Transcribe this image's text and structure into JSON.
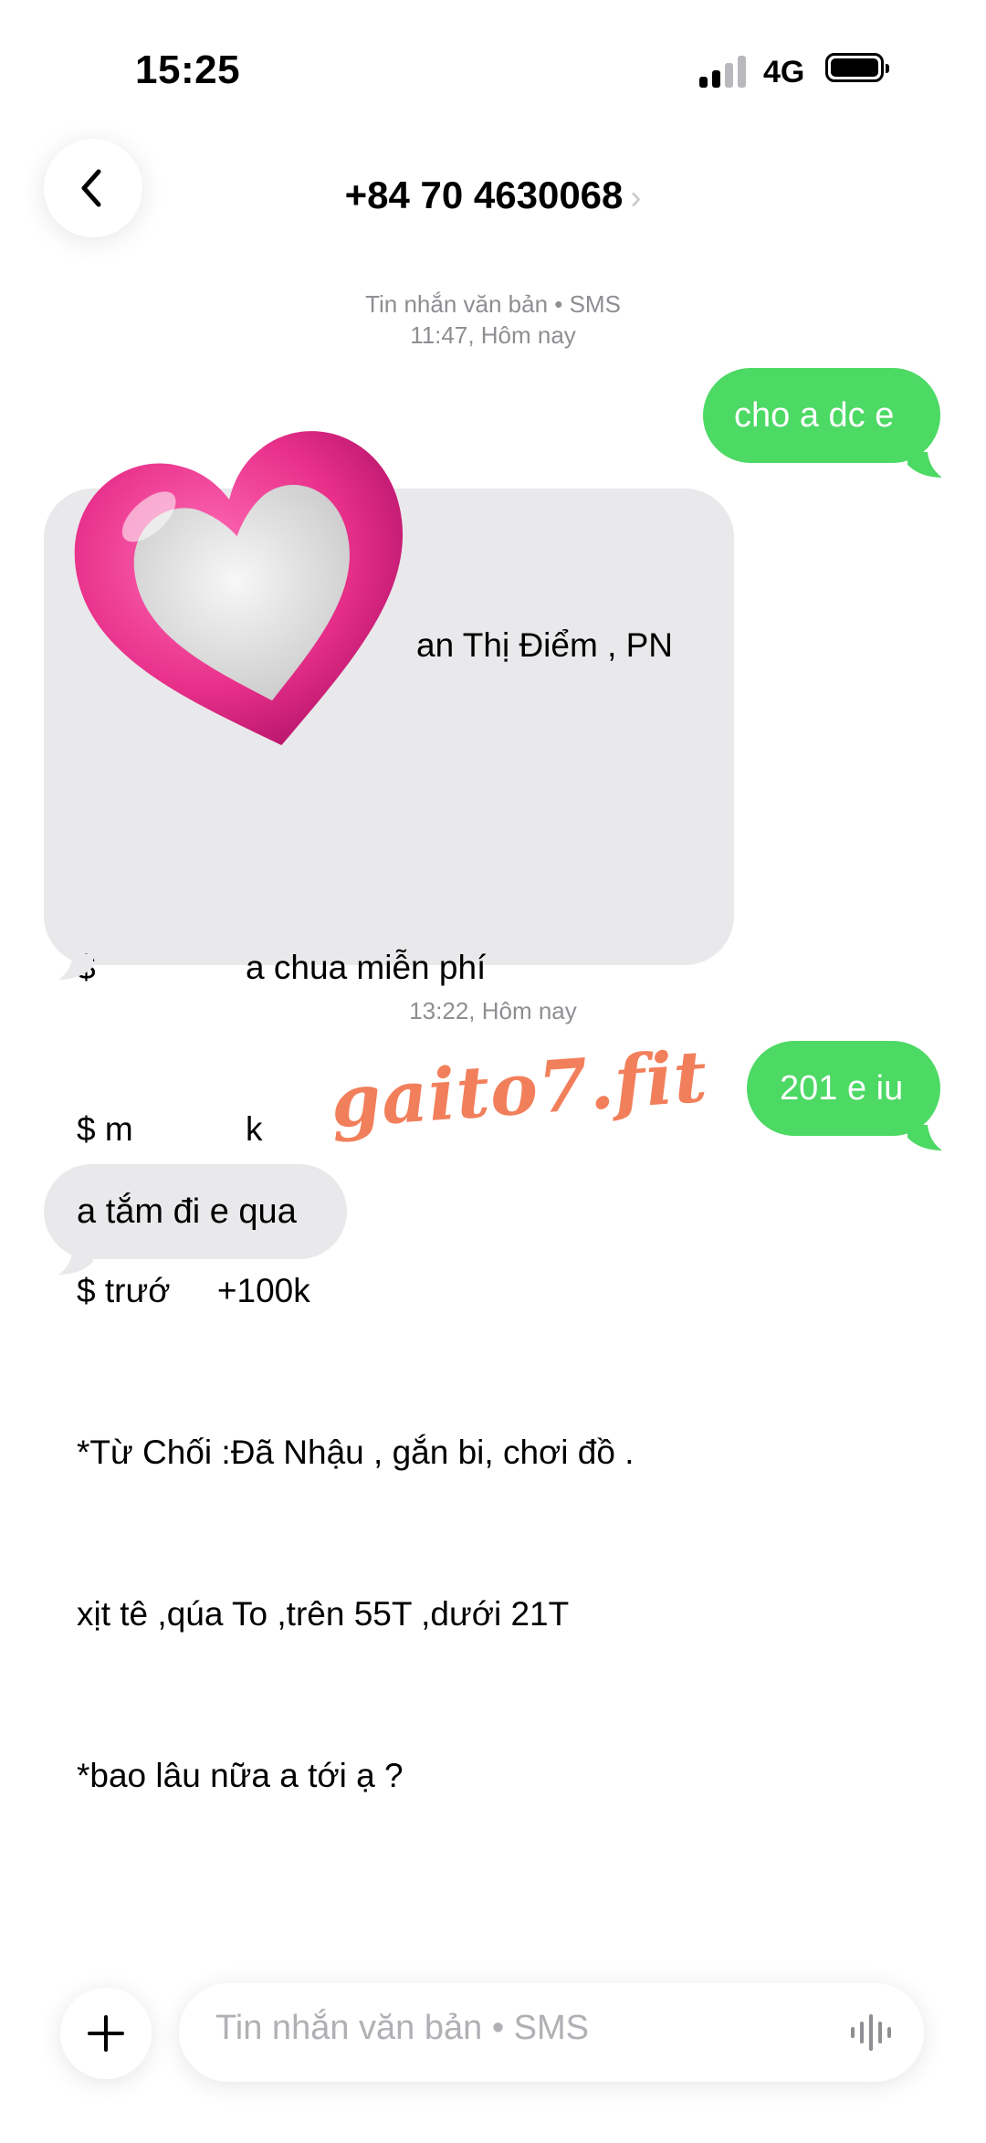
{
  "status_bar": {
    "time": "15:25",
    "network": "4G",
    "icons": [
      "signal-icon",
      "battery-icon"
    ]
  },
  "header": {
    "contact": "+84 70 4630068",
    "chevron": "›",
    "icons": [
      "back-chevron-icon",
      "chevron-right-icon"
    ]
  },
  "thread": {
    "timestamp1": {
      "line1": "Tin nhắn văn bản • SMS",
      "line2": "11:47, Hôm nay"
    },
    "timestamp2": "13:22, Hôm nay",
    "messages": [
      {
        "from": "me",
        "text": "cho a dc e"
      },
      {
        "from": "them",
        "lines": [
          "an Thị Điểm , PN",
          "$                a chua miễn phí",
          "$ m            k",
          "$ trướ     +100k",
          "*Từ Chối :Đã Nhậu , gắn bi, chơi đồ .",
          "xịt tê ,qúa To ,trên 55T ,dưới 21T",
          "*bao lâu nữa a tới ạ ?"
        ]
      },
      {
        "from": "me",
        "text": "201 e iu"
      },
      {
        "from": "them",
        "text": "a tắm đi e qua"
      }
    ]
  },
  "overlay": {
    "watermark": "gaito7.fit",
    "sticker": "heart-sticker",
    "colors": {
      "watermark": "#f27f5b",
      "heart": "#e8308a"
    }
  },
  "composer": {
    "placeholder": "Tin nhắn văn bản • SMS",
    "icons": [
      "plus-icon",
      "waveform-icon"
    ]
  },
  "colors": {
    "outgoing_bubble": "#4cd964",
    "incoming_bubble": "#e9e9eb",
    "timestamp": "#8e8e93"
  }
}
